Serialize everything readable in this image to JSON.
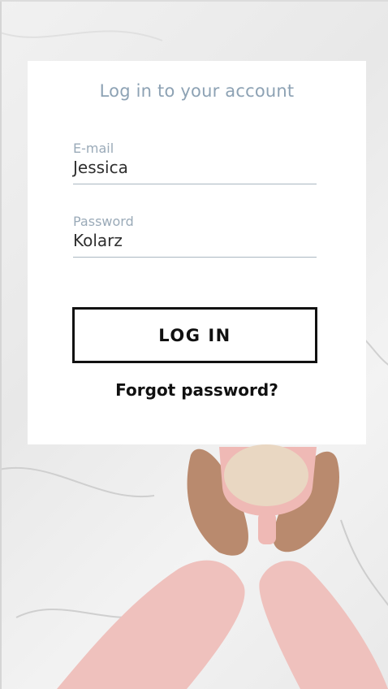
{
  "login": {
    "title": "Log in to your account",
    "email_label": "E-mail",
    "email_value": "Jessica",
    "password_label": "Password",
    "password_value": "Kolarz",
    "login_button": "LOG IN",
    "forgot_link": "Forgot password?"
  },
  "colors": {
    "title_text": "#8da2b4",
    "label_text": "#9aaab8",
    "underline": "#aab8c2",
    "button_border": "#111111",
    "sleeve": "#efc1bd",
    "mug": "#efb9b5"
  },
  "background": {
    "icon": "marble-coffee-photo"
  }
}
